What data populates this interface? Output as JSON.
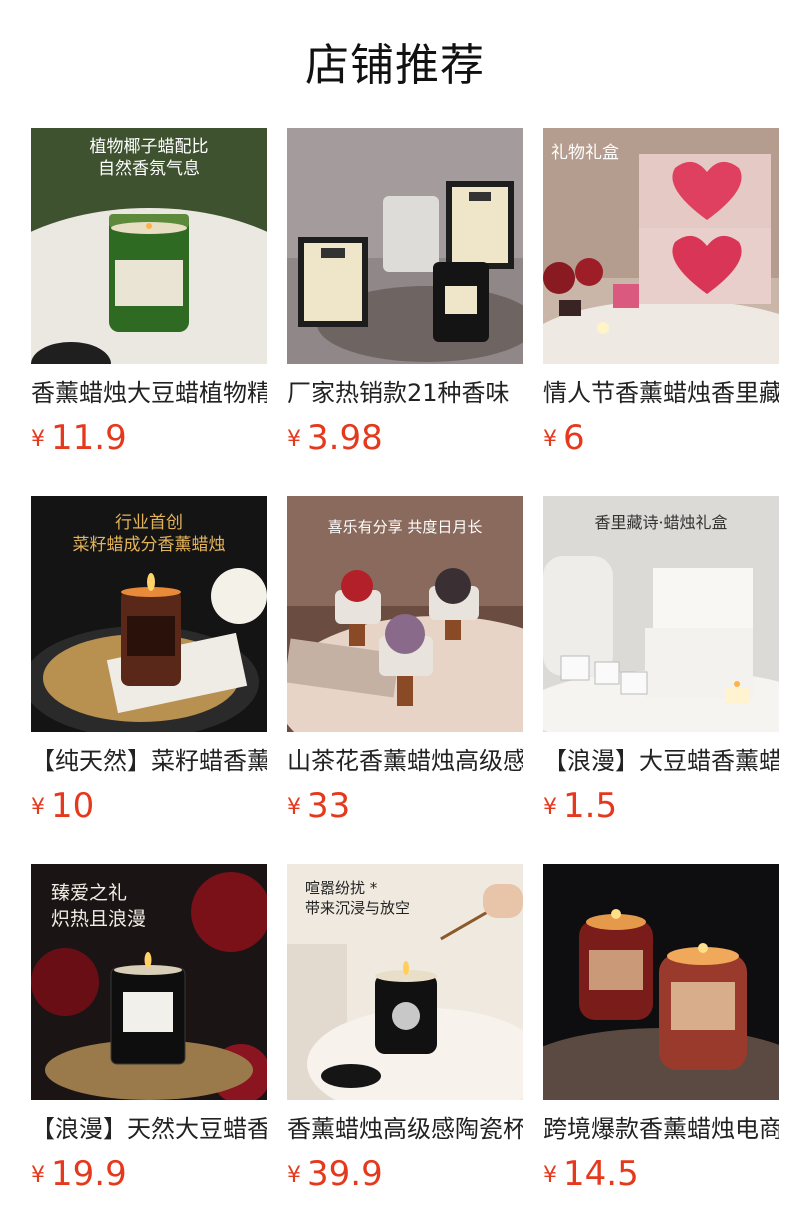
{
  "section_title": "店铺推荐",
  "currency": "¥",
  "products": [
    {
      "name": "香薰蜡烛大豆蜡植物精油",
      "price": "11.9",
      "caption": "植物椰子蜡配比\n自然香氛气息",
      "icon": "green-jar-candle-image"
    },
    {
      "name": "厂家热销款21种香味",
      "price": "3.98",
      "caption": "",
      "icon": "boxed-candles-image"
    },
    {
      "name": "情人节香薰蜡烛香里藏诗",
      "price": "6",
      "caption": "礼物礼盒",
      "icon": "heart-gift-box-image"
    },
    {
      "name": "【纯天然】菜籽蜡香薰蜡烛",
      "price": "10",
      "caption": "行业首创\n菜籽蜡成分香薰蜡烛",
      "icon": "amber-jar-candle-image"
    },
    {
      "name": "山茶花香薰蜡烛高级感",
      "price": "33",
      "caption": "喜乐有分享 共度日月长",
      "icon": "camellia-candle-image"
    },
    {
      "name": "【浪漫】大豆蜡香薰蜡烛",
      "price": "1.5",
      "caption": "香里藏诗·蜡烛礼盒",
      "icon": "white-gift-box-image"
    },
    {
      "name": "【浪漫】天然大豆蜡香薰",
      "price": "19.9",
      "caption": "臻爱之礼\n炽热且浪漫",
      "icon": "black-jar-roses-image"
    },
    {
      "name": "香薰蜡烛高级感陶瓷杯",
      "price": "39.9",
      "caption": "喧嚣纷扰 *\n带来沉浸与放空",
      "icon": "ceramic-candle-image"
    },
    {
      "name": "跨境爆款香薰蜡烛电商",
      "price": "14.5",
      "caption": "",
      "icon": "red-glass-jar-image"
    }
  ]
}
